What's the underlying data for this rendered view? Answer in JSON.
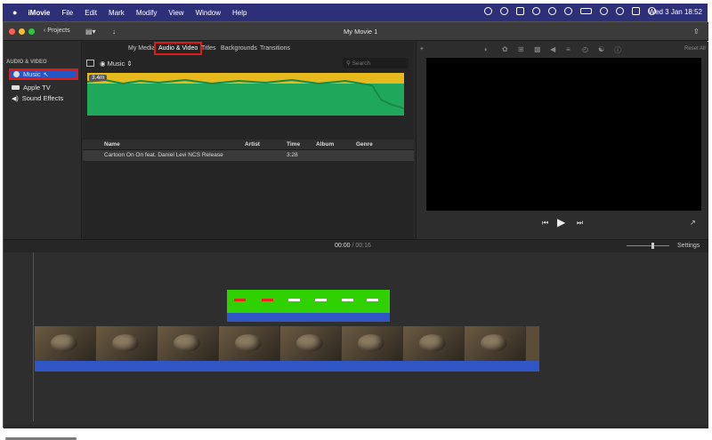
{
  "menubar": {
    "app_name": "iMovie",
    "items": [
      "File",
      "Edit",
      "Mark",
      "Modify",
      "View",
      "Window",
      "Help"
    ],
    "clock": "Wed 3 Jan  18:52",
    "apple_icon": "apple-icon"
  },
  "window": {
    "title": "My Movie 1",
    "projects_label": "Projects"
  },
  "sidebar": {
    "section_title": "AUDIO & VIDEO",
    "items": [
      {
        "label": "Music",
        "icon": "music-icon",
        "selected": true
      },
      {
        "label": "Apple TV",
        "icon": "appletv-icon",
        "selected": false
      },
      {
        "label": "Sound Effects",
        "icon": "speaker-icon",
        "selected": false
      }
    ]
  },
  "browser": {
    "tabs": [
      "My Media",
      "Audio & Video",
      "Titles",
      "Backgrounds",
      "Transitions"
    ],
    "active_tab": "Audio & Video",
    "source_select": "Music",
    "search_placeholder": "Search",
    "wave_duration": "3.4m",
    "table": {
      "headers": [
        "Name",
        "Artist",
        "Time",
        "Album",
        "Genre"
      ],
      "rows": [
        {
          "name": "Cartoon On On feat. Daniel Levi NCS Release",
          "artist": "",
          "time": "3:28",
          "album": "",
          "genre": ""
        }
      ]
    }
  },
  "viewer": {
    "reset_all": "Reset All"
  },
  "timeline": {
    "current_time": "00:00",
    "separator": "/",
    "total_time": "00:16",
    "settings_label": "Settings"
  },
  "colors": {
    "menubar_bg": "#2d2f78",
    "selection_blue": "#2457c6",
    "highlight_red": "#e01919",
    "audio_green": "#2fd100",
    "wave_green": "#1fa85c",
    "wave_yellow": "#e6b91d"
  }
}
